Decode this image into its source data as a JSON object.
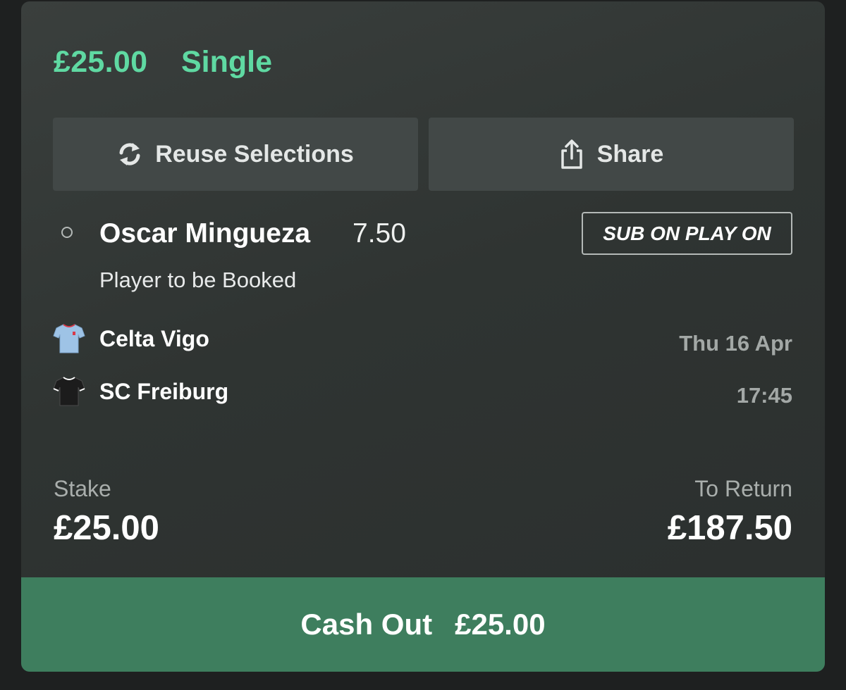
{
  "bet": {
    "stake_header": "£25.00",
    "type": "Single"
  },
  "actions": {
    "reuse_label": "Reuse Selections",
    "share_label": "Share"
  },
  "selection": {
    "name": "Oscar Mingueza",
    "odds": "7.50",
    "badge": "SUB ON PLAY ON",
    "market": "Player to be Booked"
  },
  "event": {
    "home_team": "Celta Vigo",
    "away_team": "SC Freiburg",
    "date": "Thu 16 Apr",
    "time": "17:45"
  },
  "summary": {
    "stake_label": "Stake",
    "stake_value": "£25.00",
    "return_label": "To Return",
    "return_value": "£187.50"
  },
  "cashout": {
    "label": "Cash Out",
    "amount": "£25.00"
  },
  "icons": {
    "reuse": "refresh-icon",
    "share": "share-icon",
    "home_kit": "shirt-icon",
    "away_kit": "shirt-icon"
  },
  "colors": {
    "accent": "#5fd9a2",
    "cashout": "#3e7e5e",
    "card": "#2f3432",
    "home_kit": "#9ec3e6",
    "away_kit": "#1c1c1c"
  }
}
